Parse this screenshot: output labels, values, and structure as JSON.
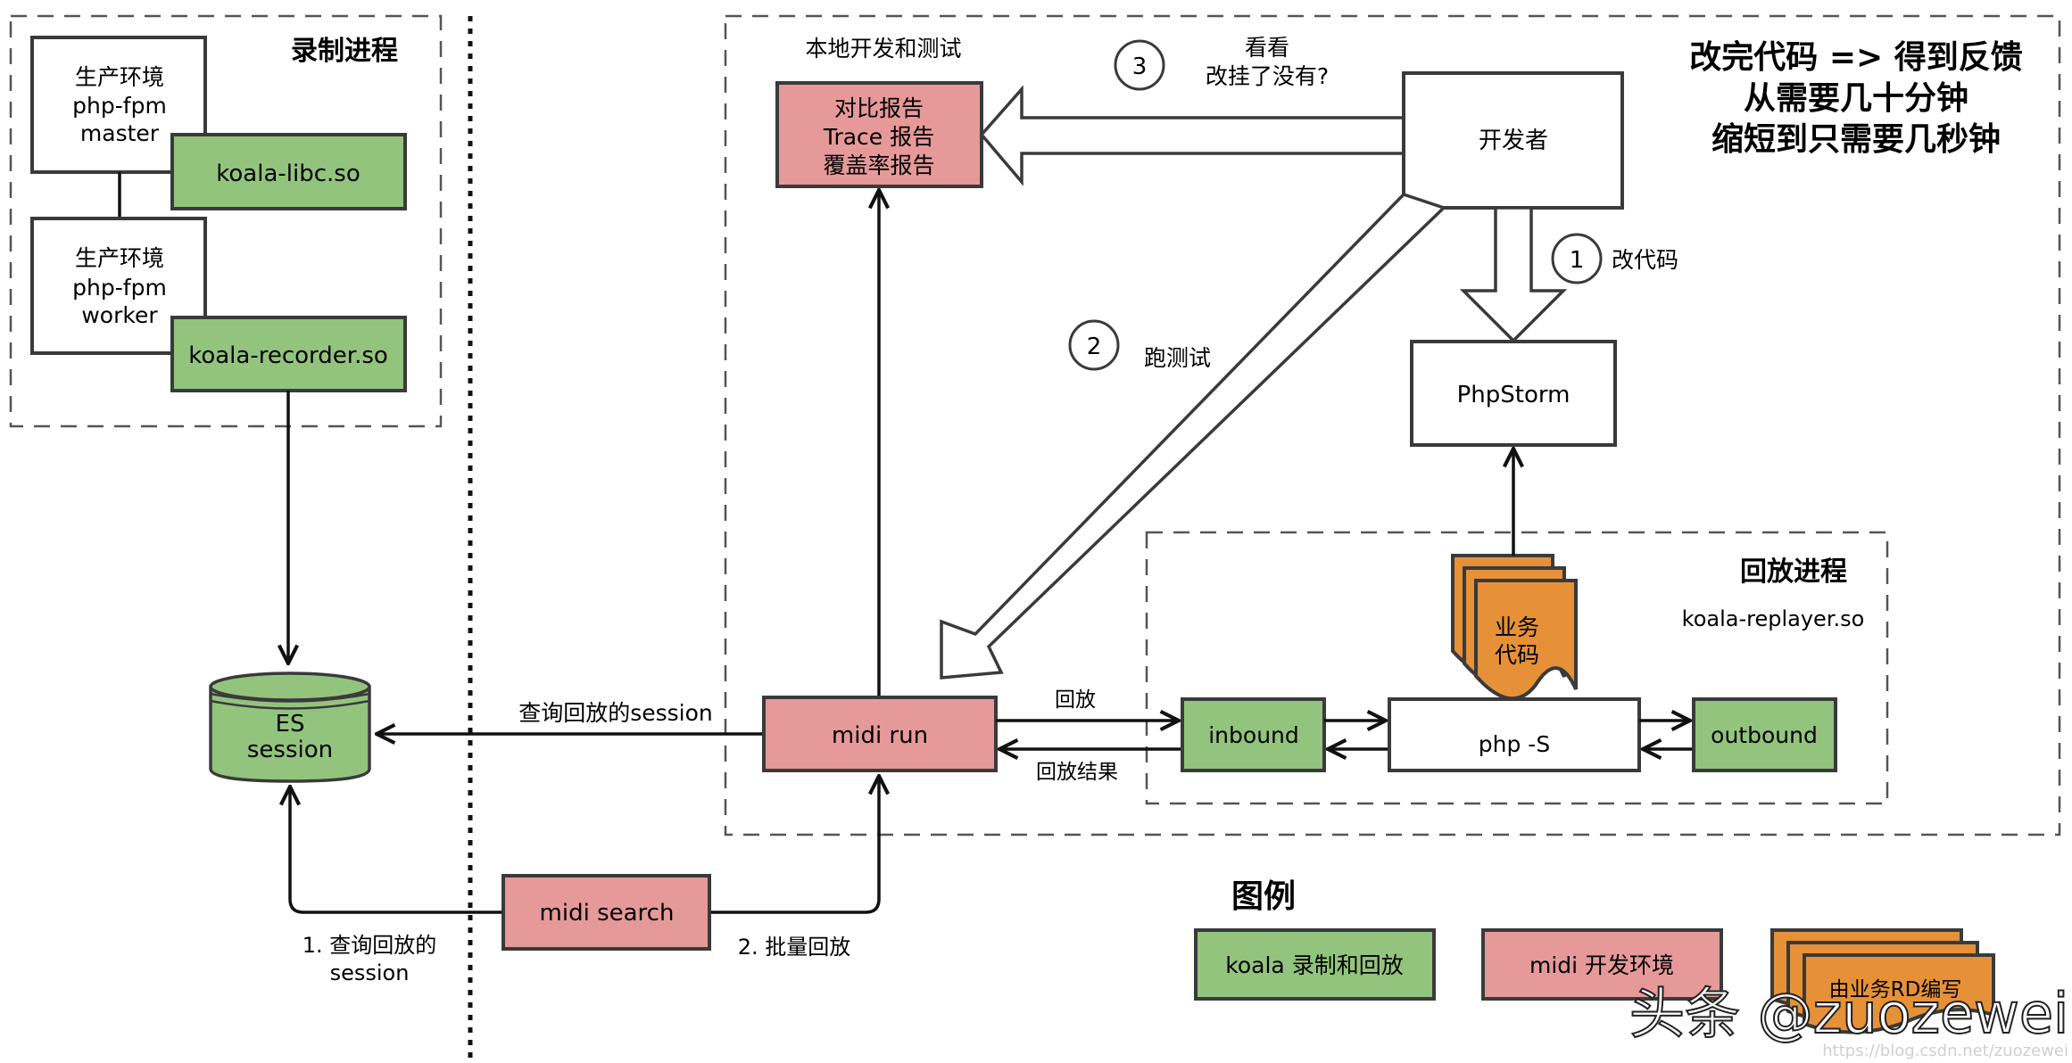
{
  "record_process": {
    "title": "录制进程",
    "master": [
      "生产环境",
      "php-fpm",
      "master"
    ],
    "worker": [
      "生产环境",
      "php-fpm",
      "worker"
    ],
    "libc": "koala-libc.so",
    "recorder": "koala-recorder.so"
  },
  "es": {
    "line1": "ES",
    "line2": "session"
  },
  "local_dev": {
    "title": "本地开发和测试",
    "report": [
      "对比报告",
      "Trace 报告",
      "覆盖率报告"
    ],
    "developer": "开发者",
    "phpstorm": "PhpStorm",
    "headline": [
      "改完代码 => 得到反馈",
      "从需要几十分钟",
      "缩短到只需要几秒钟"
    ],
    "step1": {
      "num": "1",
      "label": "改代码"
    },
    "step2": {
      "num": "2",
      "label": "跑测试"
    },
    "step3": {
      "num": "3",
      "label_line1": "看看",
      "label_line2": "改挂了没有?"
    },
    "midi_run": "midi run",
    "replay_label": "回放",
    "replay_result_label": "回放结果",
    "query_session_label": "查询回放的session"
  },
  "replay_process": {
    "title": "回放进程",
    "so": "koala-replayer.so",
    "inbound": "inbound",
    "php_s": "php -S",
    "outbound": "outbound",
    "biz_code": [
      "业务",
      "代码"
    ]
  },
  "midi_search": {
    "label": "midi search",
    "step1_label": [
      "1. 查询回放的",
      "session"
    ],
    "step2_label": "2. 批量回放"
  },
  "legend": {
    "title": "图例",
    "koala": "koala 录制和回放",
    "midi": "midi 开发环境",
    "rd": "由业务RD编写"
  },
  "watermark": {
    "main": "头条 @zuozewei",
    "url": "https://blog.csdn.net/zuozewei"
  },
  "colors": {
    "koala_green": "#93c47d",
    "midi_pink": "#e69999",
    "rd_orange": "#e69138"
  }
}
